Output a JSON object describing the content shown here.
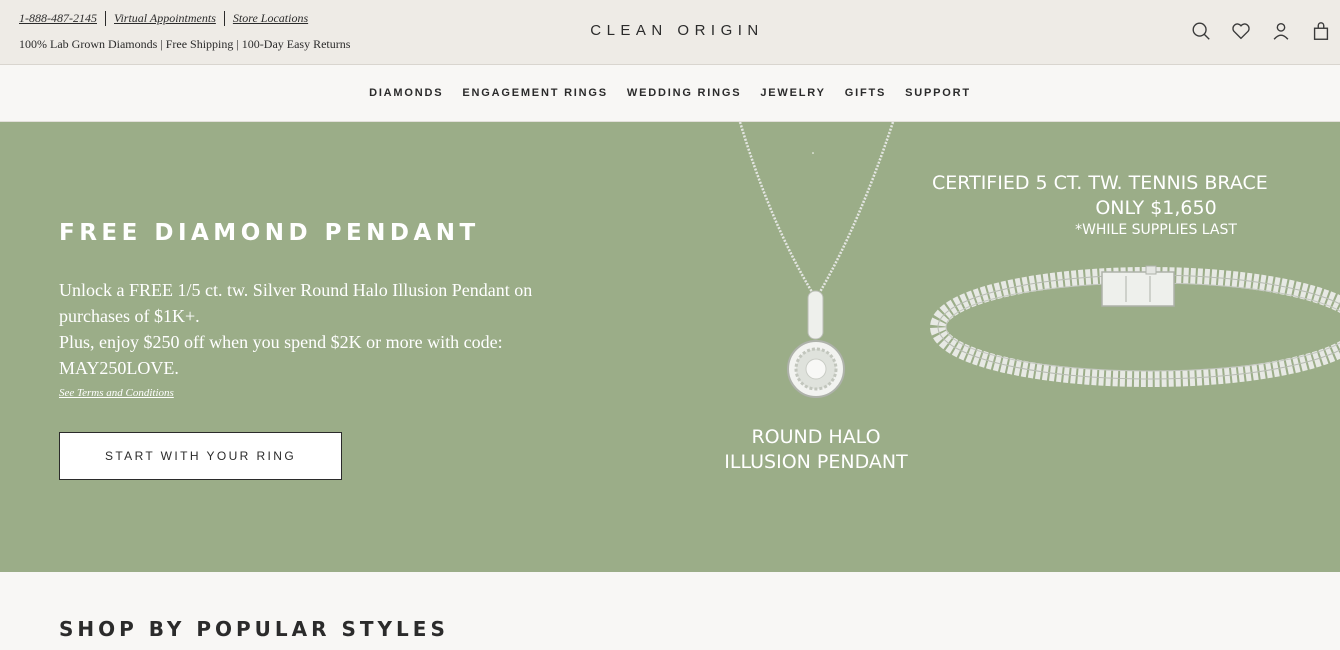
{
  "utility": {
    "phone": "1-888-487-2145",
    "virtual_appointments": "Virtual Appointments",
    "store_locations": "Store Locations",
    "tagline": "100% Lab Grown Diamonds | Free Shipping | 100-Day Easy Returns"
  },
  "brand": {
    "name": "CLEAN ORIGIN"
  },
  "header_icons": [
    "search-icon",
    "heart-icon",
    "account-icon",
    "bag-icon"
  ],
  "nav": {
    "items": [
      {
        "label": "DIAMONDS"
      },
      {
        "label": "ENGAGEMENT RINGS"
      },
      {
        "label": "WEDDING RINGS"
      },
      {
        "label": "JEWELRY"
      },
      {
        "label": "GIFTS"
      },
      {
        "label": "SUPPORT"
      }
    ]
  },
  "hero": {
    "background_color": "#9bad88",
    "title": "FREE DIAMOND PENDANT",
    "body_line1": "Unlock a FREE 1/5 ct. tw. Silver Round Halo Illusion Pendant on purchases of $1K+.",
    "body_line2": "Plus, enjoy $250 off when you spend $2K or more with code: MAY250LOVE.",
    "terms_link": "See Terms and Conditions",
    "cta_label": "START WITH YOUR RING",
    "pendant_caption_line1": "ROUND HALO",
    "pendant_caption_line2": "ILLUSION PENDANT",
    "bracelet_headline": "CERTIFIED 5 CT. TW. TENNIS BRACE",
    "bracelet_price": "ONLY $1,650",
    "bracelet_note": "*WHILE SUPPLIES LAST"
  },
  "popular": {
    "title": "SHOP BY POPULAR STYLES"
  }
}
